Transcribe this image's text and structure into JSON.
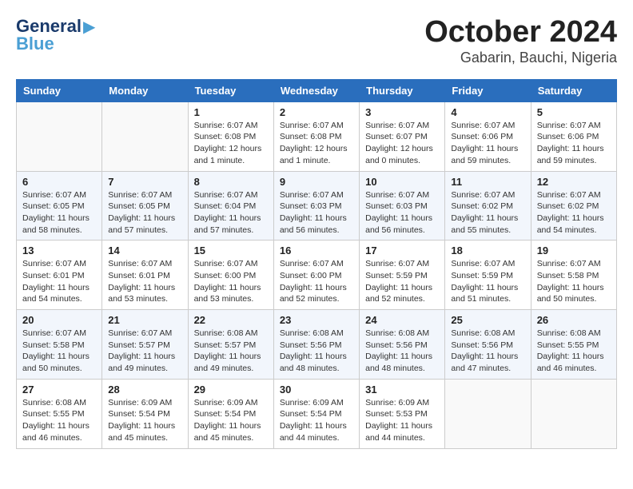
{
  "header": {
    "logo_general": "General",
    "logo_blue": "Blue",
    "title": "October 2024",
    "subtitle": "Gabarin, Bauchi, Nigeria"
  },
  "weekdays": [
    "Sunday",
    "Monday",
    "Tuesday",
    "Wednesday",
    "Thursday",
    "Friday",
    "Saturday"
  ],
  "weeks": [
    [
      {
        "day": "",
        "info": ""
      },
      {
        "day": "",
        "info": ""
      },
      {
        "day": "1",
        "info": "Sunrise: 6:07 AM\nSunset: 6:08 PM\nDaylight: 12 hours\nand 1 minute."
      },
      {
        "day": "2",
        "info": "Sunrise: 6:07 AM\nSunset: 6:08 PM\nDaylight: 12 hours\nand 1 minute."
      },
      {
        "day": "3",
        "info": "Sunrise: 6:07 AM\nSunset: 6:07 PM\nDaylight: 12 hours\nand 0 minutes."
      },
      {
        "day": "4",
        "info": "Sunrise: 6:07 AM\nSunset: 6:06 PM\nDaylight: 11 hours\nand 59 minutes."
      },
      {
        "day": "5",
        "info": "Sunrise: 6:07 AM\nSunset: 6:06 PM\nDaylight: 11 hours\nand 59 minutes."
      }
    ],
    [
      {
        "day": "6",
        "info": "Sunrise: 6:07 AM\nSunset: 6:05 PM\nDaylight: 11 hours\nand 58 minutes."
      },
      {
        "day": "7",
        "info": "Sunrise: 6:07 AM\nSunset: 6:05 PM\nDaylight: 11 hours\nand 57 minutes."
      },
      {
        "day": "8",
        "info": "Sunrise: 6:07 AM\nSunset: 6:04 PM\nDaylight: 11 hours\nand 57 minutes."
      },
      {
        "day": "9",
        "info": "Sunrise: 6:07 AM\nSunset: 6:03 PM\nDaylight: 11 hours\nand 56 minutes."
      },
      {
        "day": "10",
        "info": "Sunrise: 6:07 AM\nSunset: 6:03 PM\nDaylight: 11 hours\nand 56 minutes."
      },
      {
        "day": "11",
        "info": "Sunrise: 6:07 AM\nSunset: 6:02 PM\nDaylight: 11 hours\nand 55 minutes."
      },
      {
        "day": "12",
        "info": "Sunrise: 6:07 AM\nSunset: 6:02 PM\nDaylight: 11 hours\nand 54 minutes."
      }
    ],
    [
      {
        "day": "13",
        "info": "Sunrise: 6:07 AM\nSunset: 6:01 PM\nDaylight: 11 hours\nand 54 minutes."
      },
      {
        "day": "14",
        "info": "Sunrise: 6:07 AM\nSunset: 6:01 PM\nDaylight: 11 hours\nand 53 minutes."
      },
      {
        "day": "15",
        "info": "Sunrise: 6:07 AM\nSunset: 6:00 PM\nDaylight: 11 hours\nand 53 minutes."
      },
      {
        "day": "16",
        "info": "Sunrise: 6:07 AM\nSunset: 6:00 PM\nDaylight: 11 hours\nand 52 minutes."
      },
      {
        "day": "17",
        "info": "Sunrise: 6:07 AM\nSunset: 5:59 PM\nDaylight: 11 hours\nand 52 minutes."
      },
      {
        "day": "18",
        "info": "Sunrise: 6:07 AM\nSunset: 5:59 PM\nDaylight: 11 hours\nand 51 minutes."
      },
      {
        "day": "19",
        "info": "Sunrise: 6:07 AM\nSunset: 5:58 PM\nDaylight: 11 hours\nand 50 minutes."
      }
    ],
    [
      {
        "day": "20",
        "info": "Sunrise: 6:07 AM\nSunset: 5:58 PM\nDaylight: 11 hours\nand 50 minutes."
      },
      {
        "day": "21",
        "info": "Sunrise: 6:07 AM\nSunset: 5:57 PM\nDaylight: 11 hours\nand 49 minutes."
      },
      {
        "day": "22",
        "info": "Sunrise: 6:08 AM\nSunset: 5:57 PM\nDaylight: 11 hours\nand 49 minutes."
      },
      {
        "day": "23",
        "info": "Sunrise: 6:08 AM\nSunset: 5:56 PM\nDaylight: 11 hours\nand 48 minutes."
      },
      {
        "day": "24",
        "info": "Sunrise: 6:08 AM\nSunset: 5:56 PM\nDaylight: 11 hours\nand 48 minutes."
      },
      {
        "day": "25",
        "info": "Sunrise: 6:08 AM\nSunset: 5:56 PM\nDaylight: 11 hours\nand 47 minutes."
      },
      {
        "day": "26",
        "info": "Sunrise: 6:08 AM\nSunset: 5:55 PM\nDaylight: 11 hours\nand 46 minutes."
      }
    ],
    [
      {
        "day": "27",
        "info": "Sunrise: 6:08 AM\nSunset: 5:55 PM\nDaylight: 11 hours\nand 46 minutes."
      },
      {
        "day": "28",
        "info": "Sunrise: 6:09 AM\nSunset: 5:54 PM\nDaylight: 11 hours\nand 45 minutes."
      },
      {
        "day": "29",
        "info": "Sunrise: 6:09 AM\nSunset: 5:54 PM\nDaylight: 11 hours\nand 45 minutes."
      },
      {
        "day": "30",
        "info": "Sunrise: 6:09 AM\nSunset: 5:54 PM\nDaylight: 11 hours\nand 44 minutes."
      },
      {
        "day": "31",
        "info": "Sunrise: 6:09 AM\nSunset: 5:53 PM\nDaylight: 11 hours\nand 44 minutes."
      },
      {
        "day": "",
        "info": ""
      },
      {
        "day": "",
        "info": ""
      }
    ]
  ]
}
